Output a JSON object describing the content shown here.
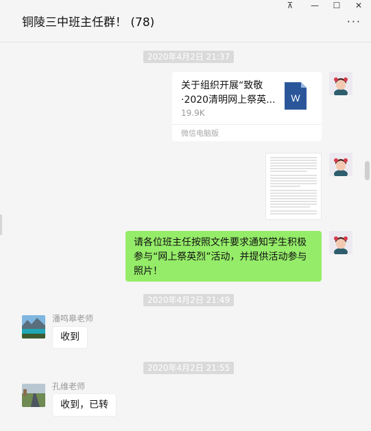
{
  "window": {
    "title": "铜陵三中班主任群！ (78)",
    "controls": {
      "pin": "⊼",
      "minimize": "—",
      "maximize": "☐",
      "close": "✕"
    },
    "more": "···"
  },
  "messages": {
    "ts1": "2020年4月2日 21:37",
    "file": {
      "name": "关于组织开展“致敬·2020清明网上祭英...",
      "size": "19.9K",
      "source": "微信电脑版",
      "icon": "word-file-icon",
      "icon_letter": "W"
    },
    "notice": "请各位班主任按照文件要求通知学生积极参与“网上祭英烈”活动，并提供活动参与照片！",
    "ts2": "2020年4月2日 21:49",
    "sender2": "潘鸣皋老师",
    "reply2": "收到",
    "ts3": "2020年4月2日 21:55",
    "sender3": "孔维老师",
    "reply3": "收到，已转"
  },
  "colors": {
    "my_bubble": "#95ec69",
    "timestamp_bg": "#dadada",
    "word_blue": "#2b579a"
  }
}
